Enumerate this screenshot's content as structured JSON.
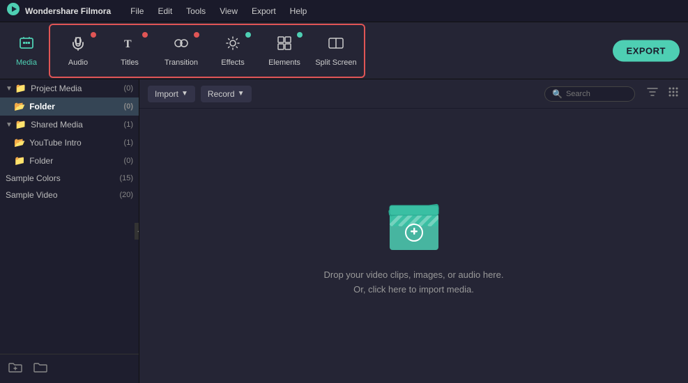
{
  "app": {
    "name": "Wondershare Filmora",
    "logo_char": "▶"
  },
  "menu": {
    "items": [
      "File",
      "Edit",
      "Tools",
      "View",
      "Export",
      "Help"
    ]
  },
  "toolbar": {
    "export_label": "EXPORT",
    "media_label": "Media",
    "audio_label": "Audio",
    "titles_label": "Titles",
    "transition_label": "Transition",
    "effects_label": "Effects",
    "elements_label": "Elements",
    "split_screen_label": "Split Screen"
  },
  "content_toolbar": {
    "import_label": "Import",
    "record_label": "Record",
    "search_placeholder": "Search",
    "filter_label": "Filter",
    "grid_label": "Grid view"
  },
  "sidebar": {
    "project_media": {
      "label": "Project Media",
      "count": "(0)"
    },
    "folder": {
      "label": "Folder",
      "count": "(0)"
    },
    "shared_media": {
      "label": "Shared Media",
      "count": "(1)"
    },
    "youtube_intro": {
      "label": "YouTube Intro",
      "count": "(1)"
    },
    "shared_folder": {
      "label": "Folder",
      "count": "(0)"
    },
    "sample_colors": {
      "label": "Sample Colors",
      "count": "(15)"
    },
    "sample_video": {
      "label": "Sample Video",
      "count": "(20)"
    },
    "footer": {
      "add_icon": "📁",
      "new_icon": "🗂"
    }
  },
  "drop_area": {
    "line1": "Drop your video clips, images, or audio here.",
    "line2": "Or, click here to import media."
  },
  "colors": {
    "accent": "#4ecfb3",
    "red_dot": "#e05555",
    "border_red": "#e05555"
  }
}
